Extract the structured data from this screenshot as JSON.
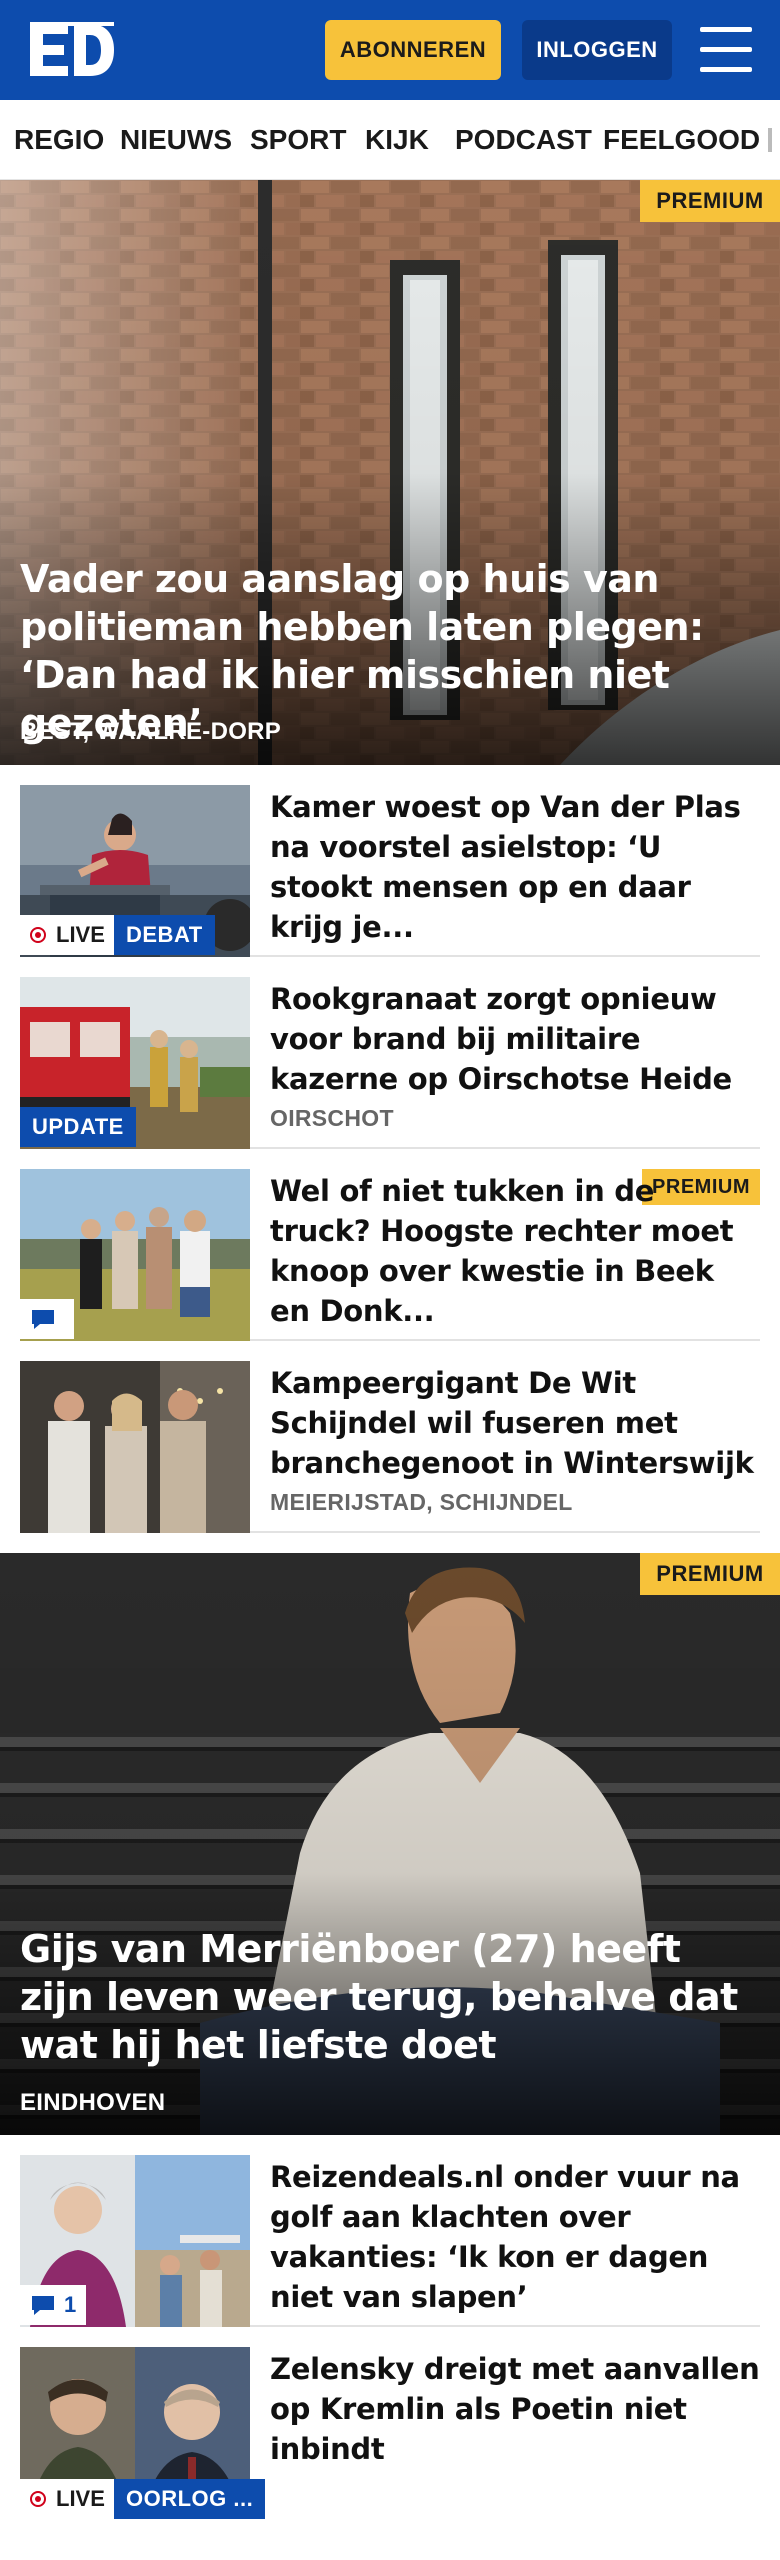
{
  "header": {
    "logo_text": "ED",
    "subscribe_label": "ABONNEREN",
    "login_label": "INLOGGEN"
  },
  "nav": {
    "items": [
      "REGIO",
      "NIEUWS",
      "SPORT",
      "KIJK",
      "PODCAST",
      "FEELGOOD"
    ]
  },
  "hero1": {
    "badge": "PREMIUM",
    "title": "Vader zou aanslag op huis van politieman hebben laten plegen: ‘Dan had ik hier misschien niet gezeten’",
    "location": "BEST, WAALRE-DORP"
  },
  "articles1": [
    {
      "title": "Kamer woest op Van der Plas na voorstel asielstop: ‘U stookt mensen op en daar krijg je...",
      "live_label": "LIVE",
      "tag": "DEBAT"
    },
    {
      "title": "Rookgranaat zorgt opnieuw voor brand bij militaire kazerne op Oirschotse Heide",
      "location": "OIRSCHOT",
      "tag": "UPDATE"
    },
    {
      "title": "Wel of niet tukken in de truck? Hoogste rechter moet knoop over kwestie in Beek en Donk...",
      "badge": "PREMIUM"
    },
    {
      "title": "Kampeergigant De Wit Schijndel wil fuseren met branchegenoot in Winterswijk",
      "location": "MEIERIJSTAD, SCHIJNDEL"
    }
  ],
  "hero2": {
    "badge": "PREMIUM",
    "title": "Gijs van Merriënboer (27) heeft zijn leven weer terug, behalve dat wat hij het liefste doet",
    "location": "EINDHOVEN"
  },
  "articles2": [
    {
      "title": "Reizendeals.nl onder vuur na golf aan klachten over vakanties: ‘Ik kon er dagen niet van slapen’",
      "comments": "1"
    },
    {
      "title": "Zelensky dreigt met aanvallen op Kremlin als Poetin niet inbindt",
      "live_label": "LIVE",
      "tag": "OORLOG ..."
    }
  ],
  "colors": {
    "brand_blue": "#0d4cad",
    "premium_yellow": "#f7c23a",
    "live_red": "#d0021b"
  }
}
